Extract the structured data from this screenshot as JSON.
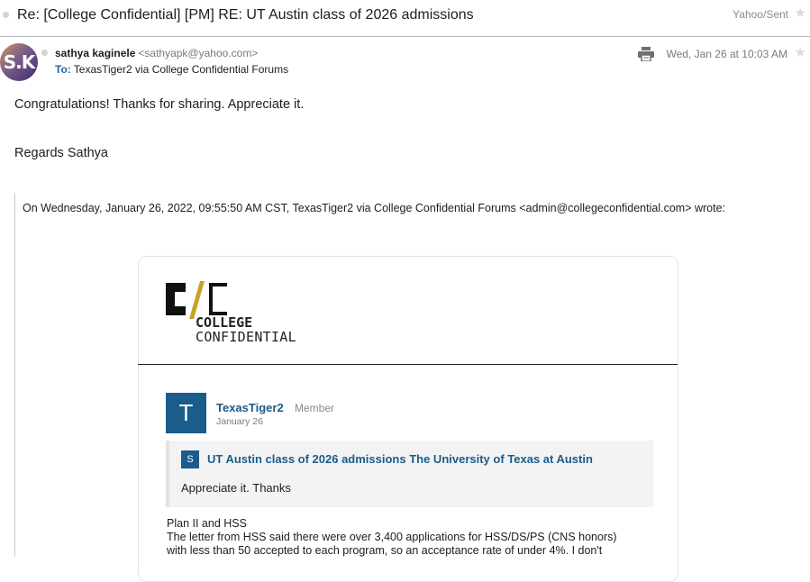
{
  "header": {
    "subject": "Re: [College Confidential] [PM] RE: UT Austin class of 2026 admissions",
    "folder": "Yahoo/Sent",
    "star_icon": "star-icon"
  },
  "sender": {
    "avatar_initials": "S.K",
    "name": "sathya kaginele",
    "email": "<sathyapk@yahoo.com>",
    "to_label": "To:",
    "to_value": "TexasTiger2 via College Confidential Forums",
    "date": "Wed, Jan 26 at 10:03 AM",
    "print_icon": "print-icon"
  },
  "body": {
    "line1": "Congratulations! Thanks for sharing. Appreciate it.",
    "line2": "Regards Sathya",
    "quoted_header": "On Wednesday, January 26, 2022, 09:55:50 AM CST, TexasTiger2 via College Confidential Forums <admin@collegeconfidential.com> wrote:"
  },
  "card": {
    "logo_mark": "C/C",
    "logo_line1": "COLLEGE",
    "logo_line2": "CONFIDENTIAL",
    "user_initial": "T",
    "username": "TexasTiger2",
    "role": "Member",
    "post_date": "January 26",
    "category_badge": "S",
    "topic": "UT Austin class of 2026 admissions The University of Texas at Austin",
    "quote": "Appreciate it. Thanks",
    "post_lines": [
      "Plan II and HSS",
      "The letter from HSS said there were over 3,400 applications for HSS/DS/PS (CNS honors)",
      "with less than 50 accepted to each program, so an acceptance rate of under 4%. I don't"
    ]
  },
  "colors": {
    "link_blue": "#1a5c8a",
    "to_blue": "#2e62a6",
    "muted": "#7a7a7a"
  }
}
